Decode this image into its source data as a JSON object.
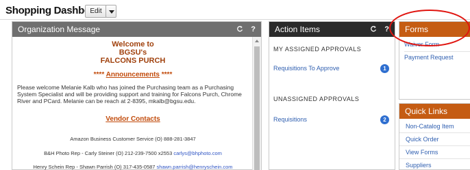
{
  "header": {
    "title": "Shopping Dashboard",
    "edit_label": "Edit"
  },
  "org_message": {
    "title": "Organization Message",
    "refresh_icon": "refresh-icon",
    "help_label": "?",
    "welcome_line1": "Welcome to",
    "welcome_line2": "BGSU's",
    "welcome_line3": "FALCONS PURCH",
    "announcements_stars_left": "****",
    "announcements_label": "Announcements",
    "announcements_stars_right": "****",
    "announcement_text": "Please welcome Melanie Kalb who has joined the Purchasing team as a Purchasing System Specialist and will be providing support and training for Falcons Purch, Chrome River and PCard. Melanie can be reach at 2-8395, mkalb@bgsu.edu.",
    "vendor_contacts_label": "Vendor Contacts",
    "contacts": [
      {
        "text": "Amazon Business Customer Service (O) 888-281-3847",
        "email": ""
      },
      {
        "text": "B&H Photo Rep - Carly Steiner (O) 212-239-7500 x2553 ",
        "email": "carlys@bhphoto.com"
      },
      {
        "text": "Henry Schein Rep - Shawn Parrish (O) 317-435-0587 ",
        "email": "shawn.parrish@henryschein.com"
      }
    ]
  },
  "action_items": {
    "title": "Action Items",
    "help_label": "?",
    "assigned_title": "MY ASSIGNED APPROVALS",
    "assigned_link": "Requisitions To Approve",
    "assigned_count": "1",
    "unassigned_title": "UNASSIGNED APPROVALS",
    "unassigned_link": "Requisitions",
    "unassigned_count": "2"
  },
  "forms": {
    "title": "Forms",
    "items": [
      "Waiver Form",
      "Payment Request"
    ]
  },
  "quick_links": {
    "title": "Quick Links",
    "items": [
      "Non-Catalog Item",
      "Quick Order",
      "View Forms",
      "Suppliers"
    ]
  },
  "colors": {
    "accent_orange": "#c55c13",
    "link_blue": "#2f5fb0",
    "highlight_red": "#e0140f"
  }
}
